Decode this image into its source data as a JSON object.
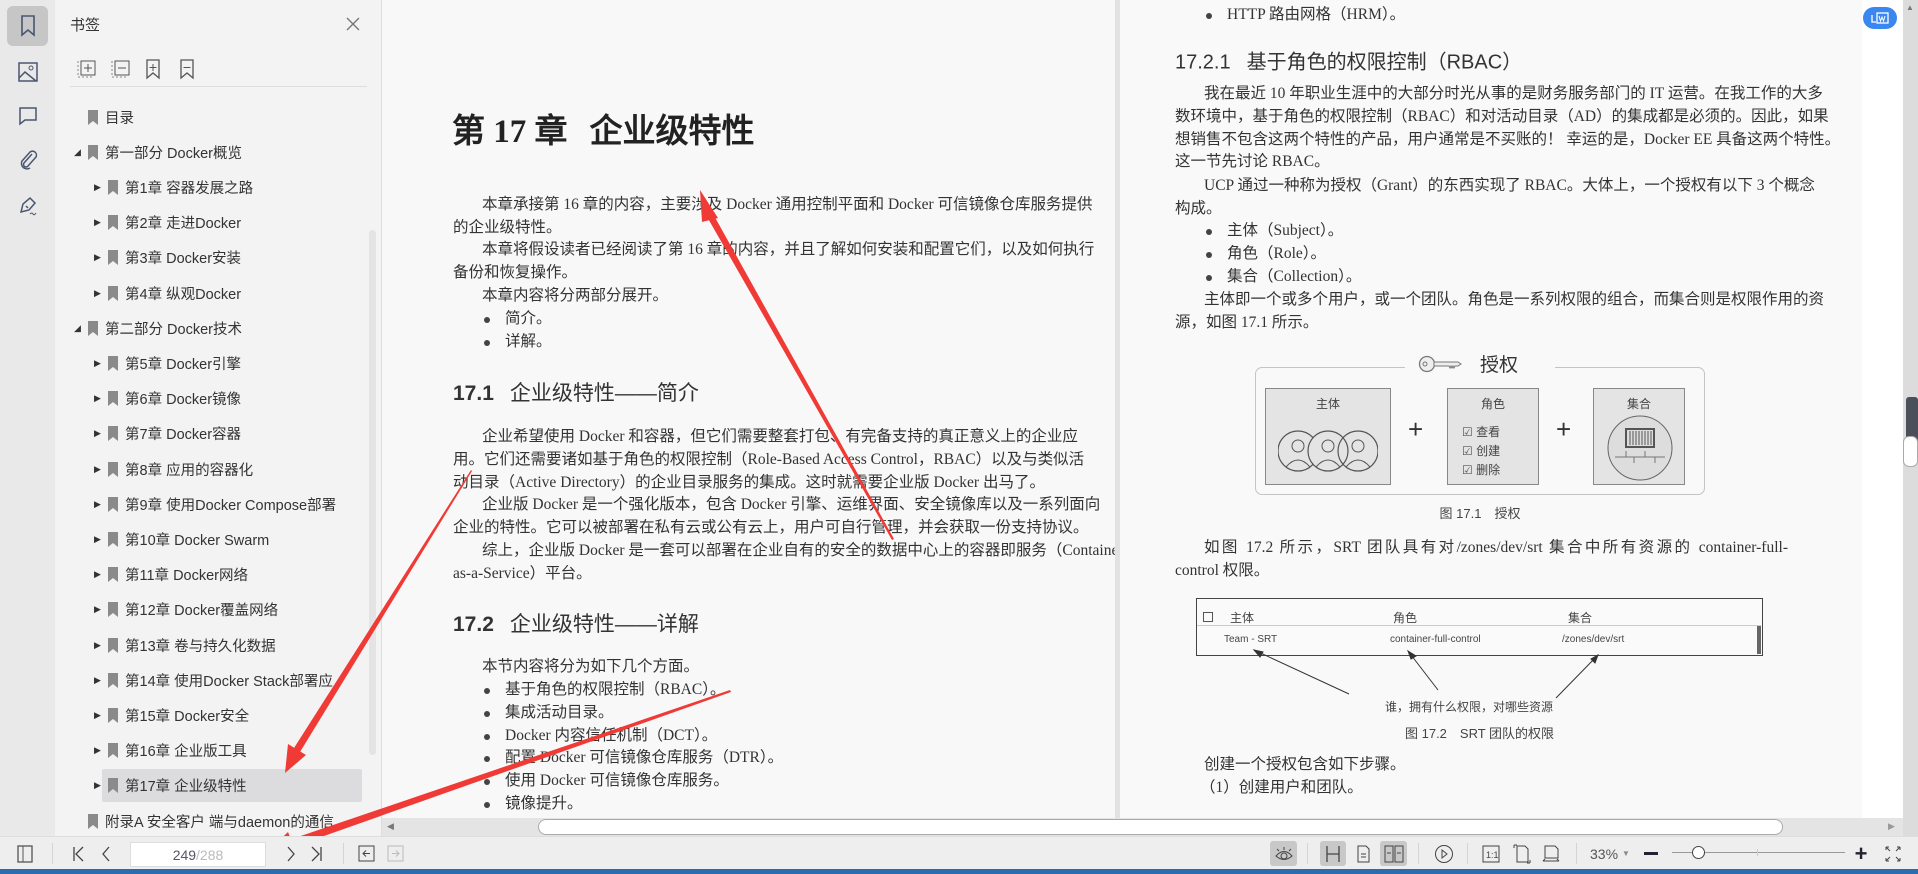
{
  "rail": {
    "icons": [
      "bookmark-icon",
      "image-icon",
      "comment-icon",
      "attachment-icon",
      "signature-icon"
    ]
  },
  "sidebar": {
    "title": "书签",
    "items": [
      {
        "label": "目录",
        "level": 0,
        "expander": ""
      },
      {
        "label": "第一部分 Docker概览",
        "level": 1,
        "expander": "◢"
      },
      {
        "label": "第1章 容器发展之路",
        "level": 2,
        "expander": "▶"
      },
      {
        "label": "第2章 走进Docker",
        "level": 2,
        "expander": "▶"
      },
      {
        "label": "第3章 Docker安装",
        "level": 2,
        "expander": "▶"
      },
      {
        "label": "第4章 纵观Docker",
        "level": 2,
        "expander": "▶"
      },
      {
        "label": "第二部分 Docker技术",
        "level": 1,
        "expander": "◢"
      },
      {
        "label": "第5章 Docker引擎",
        "level": 2,
        "expander": "▶"
      },
      {
        "label": "第6章 Docker镜像",
        "level": 2,
        "expander": "▶"
      },
      {
        "label": "第7章 Docker容器",
        "level": 2,
        "expander": "▶"
      },
      {
        "label": "第8章 应用的容器化",
        "level": 2,
        "expander": "▶"
      },
      {
        "label": "第9章 使用Docker Compose部署",
        "level": 2,
        "expander": "▶"
      },
      {
        "label": "第10章 Docker Swarm",
        "level": 2,
        "expander": "▶"
      },
      {
        "label": "第11章 Docker网络",
        "level": 2,
        "expander": "▶"
      },
      {
        "label": "第12章 Docker覆盖网络",
        "level": 2,
        "expander": "▶"
      },
      {
        "label": "第13章 卷与持久化数据",
        "level": 2,
        "expander": "▶"
      },
      {
        "label": "第14章 使用Docker Stack部署应",
        "level": 2,
        "expander": "▶"
      },
      {
        "label": "第15章 Docker安全",
        "level": 2,
        "expander": "▶"
      },
      {
        "label": "第16章 企业版工具",
        "level": 2,
        "expander": "▶"
      },
      {
        "label": "第17章 企业级特性",
        "level": 2,
        "expander": "▶",
        "selected": true
      },
      {
        "label": "附录A 安全客户 端与daemon的通信",
        "level": 0,
        "expander": ""
      }
    ]
  },
  "left_page": {
    "chapter_no": "第 17 章",
    "chapter_title": "企业级特性",
    "p1": [
      "本章承接第 16 章的内容，主要涉及 Docker 通用控制平面和 Docker 可信镜像仓库服务提供",
      "的企业级特性。"
    ],
    "p2": [
      "本章将假设读者已经阅读了第 16 章的内容，并且了解如何安装和配置它们，以及如何执行",
      "备份和恢复操作。"
    ],
    "p3": [
      "本章内容将分两部分展开。"
    ],
    "b1": [
      "简介。"
    ],
    "b2": [
      "详解。"
    ],
    "h1_num": "17.1",
    "h1_text": "企业级特性——简介",
    "p4": [
      "企业希望使用 Docker 和容器，但它们需要整套打包、有完备支持的真正意义上的企业应",
      "用。它们还需要诸如基于角色的权限控制（Role-Based Access Control，RBAC）以及与类似活",
      "动目录（Active Directory）的企业目录服务的集成。这时就需要企业版 Docker 出马了。"
    ],
    "p5": [
      "企业版 Docker 是一个强化版本，包含 Docker 引擎、运维界面、安全镜像库以及一系列面向",
      "企业的特性。它可以被部署在私有云或公有云上，用户可自行管理，并会获取一份支持协议。"
    ],
    "p6": [
      "综上，企业版 Docker 是一套可以部署在企业自有的安全的数据中心上的容器即服务（Container-",
      "as-a-Service）平台。"
    ],
    "h2_num": "17.2",
    "h2_text": "企业级特性——详解",
    "p7": [
      "本节内容将分为如下几个方面。"
    ],
    "list": [
      "基于角色的权限控制（RBAC）。",
      "集成活动目录。",
      "Docker 内容信任机制（DCT）。",
      "配置 Docker 可信镜像仓库服务（DTR）。",
      "使用 Docker 可信镜像仓库服务。",
      "镜像提升。"
    ]
  },
  "right_page": {
    "b0": [
      "HTTP 路由网格（HRM）。"
    ],
    "h_num": "17.2.1",
    "h_text": "基于角色的权限控制（RBAC）",
    "p1": [
      "我在最近 10 年职业生涯中的大部分时光从事的是财务服务部门的 IT 运营。在我工作的大多",
      "数环境中，基于角色的权限控制（RBAC）和对活动目录（AD）的集成都是必须的。因此，如果",
      "想销售不包含这两个特性的产品，用户通常是不买账的！ 幸运的是，Docker EE 具备这两个特性。",
      "这一节先讨论 RBAC。"
    ],
    "p2": [
      "UCP 通过一种称为授权（Grant）的东西实现了 RBAC。大体上，一个授权有以下 3 个概念",
      "构成。"
    ],
    "bl": [
      [
        "主体（Subject）。"
      ],
      [
        "角色（Role）。"
      ],
      [
        "集合（Collection）。"
      ]
    ],
    "p3": [
      "主体即一个或多个用户，或一个团队。角色是一系列权限的组合，而集合则是权限作用的资",
      "源，如图 17.1 所示。"
    ],
    "fig1": {
      "title": "授权",
      "subject": "主体",
      "role": "角色",
      "perms": [
        "查看",
        "创建",
        "删除"
      ],
      "collection": "集合",
      "caption": "图 17.1　授权"
    },
    "p4": [
      "如图 17.2 所示，SRT 团队具有对/zones/dev/srt 集合中所有资源的 container-full-",
      "control 权限。"
    ],
    "fig2": {
      "headers": [
        "主体",
        "角色",
        "集合"
      ],
      "row": [
        "Team - SRT",
        "container-full-control",
        "/zones/dev/srt"
      ],
      "annotation": "谁，拥有什么权限，对哪些资源",
      "caption": "图 17.2　SRT 团队的权限"
    },
    "p5": [
      "创建一个授权包含如下步骤。"
    ],
    "p6": [
      "（1）创建用户和团队。"
    ]
  },
  "toolbar": {
    "page_current": "249",
    "page_total": "/288",
    "zoom": "33%",
    "zoom_fraction": 0.15
  },
  "colors": {
    "accent": "#3b87f0",
    "annotation_arrow": "#f03a35",
    "taskbar": "#2b6cb0"
  }
}
